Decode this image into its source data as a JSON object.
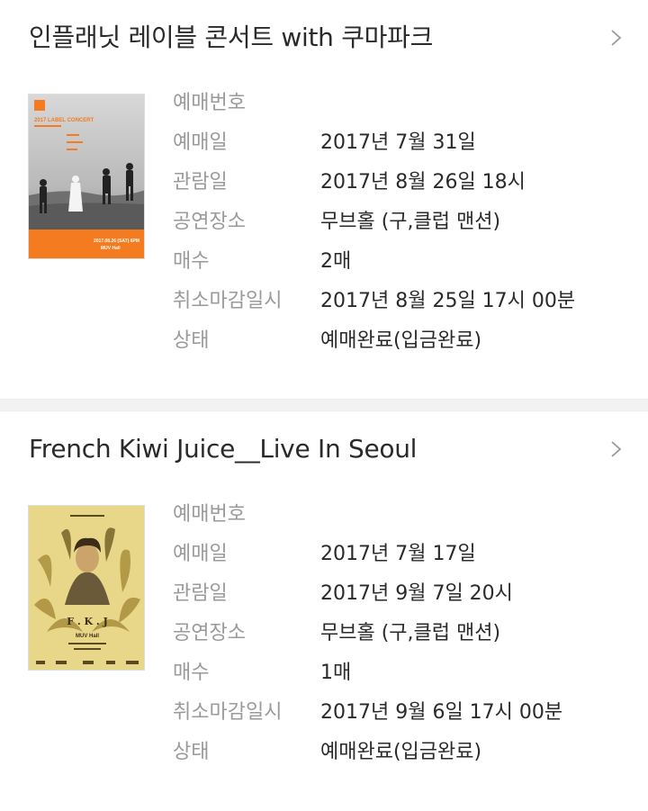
{
  "labels": {
    "booking_number": "예매번호",
    "booking_date": "예매일",
    "viewing_date": "관람일",
    "venue": "공연장소",
    "ticket_count": "매수",
    "cancel_deadline": "취소마감일시",
    "status": "상태"
  },
  "bookings": [
    {
      "title": "인플래닛 레이블 콘서트 with 쿠마파크",
      "booking_number": "",
      "booking_date": "2017년 7월 31일",
      "viewing_date": "2017년 8월 26일 18시",
      "venue": "무브홀 (구,클럽 맨션)",
      "ticket_count": "2매",
      "cancel_deadline": "2017년 8월 25일 17시 00분",
      "status": "예매완료(입금완료)",
      "poster": {
        "small_text": "2017 LABEL CONCERT",
        "date_text": "2017.08.26 (SAT) 6PM",
        "venue_text": "MUV Hall",
        "accent_color": "#f47b20"
      }
    },
    {
      "title": "French Kiwi Juice__Live In Seoul",
      "booking_number": "",
      "booking_date": "2017년 7월 17일",
      "viewing_date": "2017년 9월 7일 20시",
      "venue": "무브홀 (구,클럽 맨션)",
      "ticket_count": "1매",
      "cancel_deadline": "2017년 9월 6일 17시 00분",
      "status": "예매완료(입금완료)",
      "poster": {
        "monogram": "F . K . J",
        "venue_text": "MUV Hall",
        "accent_color": "#e8d789"
      }
    }
  ],
  "icons": {
    "chevron": "chevron-right-icon"
  },
  "colors": {
    "label": "#9a9a9a",
    "value": "#2a2a2a",
    "separator": "#f2f2f2"
  }
}
